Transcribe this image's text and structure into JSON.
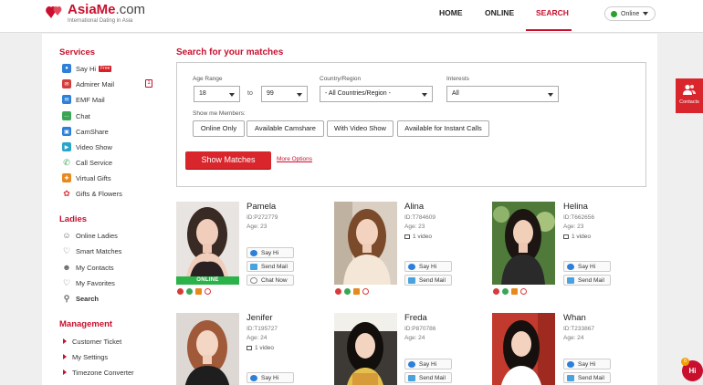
{
  "header": {
    "brand_main": "AsiaMe",
    "brand_suffix": ".com",
    "tagline": "International Dating in Asia",
    "nav": [
      {
        "label": "HOME",
        "active": false
      },
      {
        "label": "ONLINE",
        "active": false
      },
      {
        "label": "SEARCH",
        "active": true
      }
    ],
    "status": "Online"
  },
  "sidebar": {
    "services_heading": "Services",
    "services": [
      {
        "label": "Say Hi",
        "icon": "say-hi-icon",
        "badge": "Free"
      },
      {
        "label": "Admirer Mail",
        "icon": "admirer-mail-icon",
        "count": "1"
      },
      {
        "label": "EMF Mail",
        "icon": "emf-mail-icon"
      },
      {
        "label": "Chat",
        "icon": "chat-icon"
      },
      {
        "label": "CamShare",
        "icon": "camshare-icon"
      },
      {
        "label": "Video Show",
        "icon": "video-show-icon"
      },
      {
        "label": "Call Service",
        "icon": "phone-icon"
      },
      {
        "label": "Virtual Gifts",
        "icon": "gift-icon"
      },
      {
        "label": "Gifts & Flowers",
        "icon": "flower-icon"
      }
    ],
    "ladies_heading": "Ladies",
    "ladies": [
      {
        "label": "Online Ladies",
        "icon": "person-icon"
      },
      {
        "label": "Smart Matches",
        "icon": "heart-handshake-icon"
      },
      {
        "label": "My Contacts",
        "icon": "contacts-icon"
      },
      {
        "label": "My Favorites",
        "icon": "heart-icon"
      },
      {
        "label": "Search",
        "icon": "search-icon",
        "active": true
      }
    ],
    "management_heading": "Management",
    "management": [
      {
        "label": "Customer Ticket"
      },
      {
        "label": "My Settings"
      },
      {
        "label": "Timezone Converter"
      }
    ]
  },
  "search": {
    "title": "Search for your matches",
    "age_label": "Age Range",
    "age_from": "18",
    "age_to_label": "to",
    "age_to": "99",
    "country_label": "Country/Region",
    "country_value": "- All Countries/Region -",
    "interests_label": "Interests",
    "interests_value": "All",
    "members_label": "Show me Members:",
    "member_filters": [
      "Online Only",
      "Available Camshare",
      "With Video Show",
      "Available for Instant Calls"
    ],
    "submit_label": "Show Matches",
    "more_options": "More Options"
  },
  "profiles": [
    {
      "name": "Pamela",
      "id": "ID:P272779",
      "age": "Age: 23",
      "online": "ONLINE",
      "buttons": [
        "Say Hi",
        "Send Mail",
        "Chat Now"
      ]
    },
    {
      "name": "Alina",
      "id": "ID:T784609",
      "age": "Age: 23",
      "video": "1 video",
      "buttons": [
        "Say Hi",
        "Send Mail"
      ]
    },
    {
      "name": "Helina",
      "id": "ID:T662656",
      "age": "Age: 23",
      "video": "1 video",
      "buttons": [
        "Say Hi",
        "Send Mail"
      ]
    },
    {
      "name": "Jenifer",
      "id": "ID:T195727",
      "age": "Age: 24",
      "video": "1 video",
      "buttons": [
        "Say Hi"
      ]
    },
    {
      "name": "Freda",
      "id": "ID:P870786",
      "age": "Age: 24",
      "buttons": [
        "Say Hi",
        "Send Mail"
      ]
    },
    {
      "name": "Whan",
      "id": "ID:T233867",
      "age": "Age: 24",
      "buttons": [
        "Say Hi",
        "Send Mail"
      ]
    }
  ],
  "widgets": {
    "contacts_label": "Contacts",
    "hi_label": "Hi",
    "hi_count": "0"
  },
  "colors": {
    "brand_red": "#c8102e",
    "button_red": "#d8262c",
    "online_green": "#2bb34a"
  }
}
